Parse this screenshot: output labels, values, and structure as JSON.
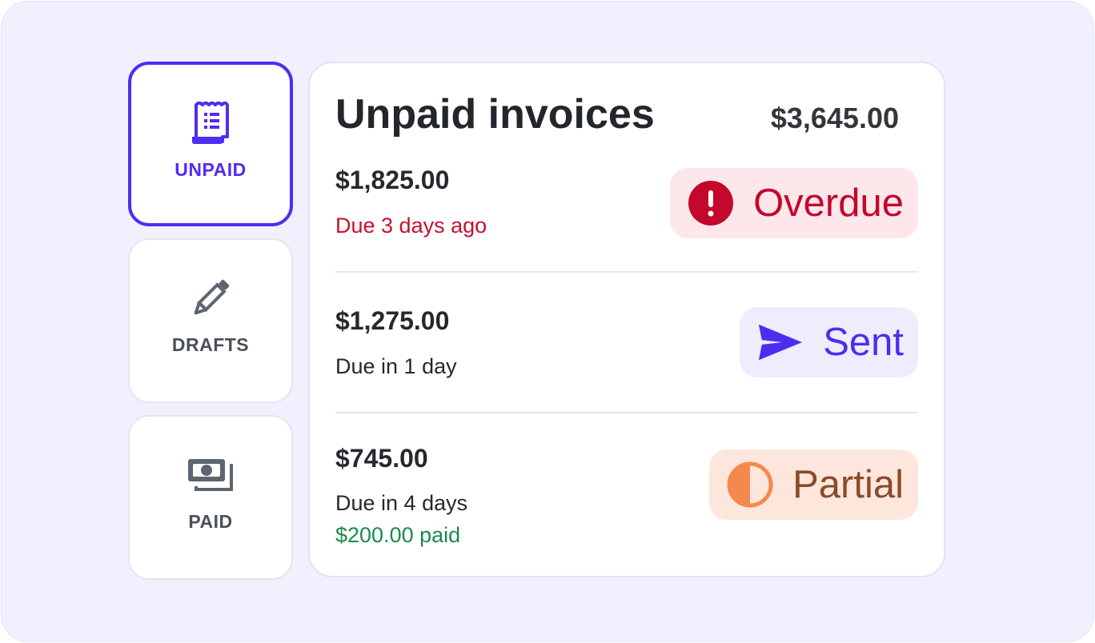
{
  "tabs": [
    {
      "label": "UNPAID",
      "icon": "receipt-icon",
      "active": true
    },
    {
      "label": "DRAFTS",
      "icon": "pencil-icon",
      "active": false
    },
    {
      "label": "PAID",
      "icon": "banknotes-icon",
      "active": false
    }
  ],
  "card": {
    "title": "Unpaid invoices",
    "total": "$3,645.00"
  },
  "invoices": [
    {
      "amount": "$1,825.00",
      "due": "Due 3 days ago",
      "status": "Overdue",
      "status_icon": "alert-circle-icon"
    },
    {
      "amount": "$1,275.00",
      "due": "Due in 1 day",
      "status": "Sent",
      "status_icon": "send-icon"
    },
    {
      "amount": "$745.00",
      "due": "Due in 4 days",
      "paid_note": "$200.00 paid",
      "status": "Partial",
      "status_icon": "half-circle-icon"
    }
  ],
  "colors": {
    "accent": "#4f2cf2",
    "overdue": "#c4072c",
    "paid": "#1b8a4b",
    "partial": "#8b4a2a"
  }
}
